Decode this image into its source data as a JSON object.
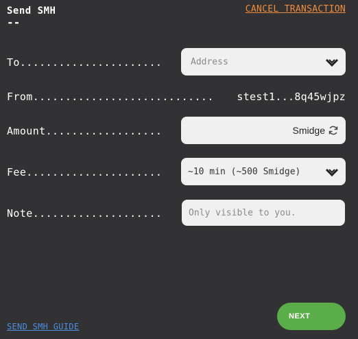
{
  "header": {
    "title": "Send SMH",
    "subtitle": "--",
    "cancel_label": "CANCEL TRANSACTION"
  },
  "form": {
    "to": {
      "label": "To......................",
      "placeholder": "Address"
    },
    "from": {
      "label": "From............................",
      "value": "stest1...8q45wjpz"
    },
    "amount": {
      "label": "Amount..................",
      "unit": "Smidge"
    },
    "fee": {
      "label": "Fee.....................",
      "value": "~10 min (~500 Smidge)"
    },
    "note": {
      "label": "Note....................",
      "placeholder": "Only visible to you."
    }
  },
  "footer": {
    "guide_label": "SEND SMH GUIDE",
    "next_label": "NEXT"
  },
  "colors": {
    "background": "#323234",
    "cancel_link": "#f08c3c",
    "guide_link": "#4b8ee0",
    "next_button": "#5bad4a",
    "field_bg": "#f0f0f0"
  },
  "icons": {
    "to_dropdown": "chevron-down-icon",
    "amount_unit_toggle": "refresh-icon",
    "fee_dropdown": "chevron-down-icon"
  }
}
